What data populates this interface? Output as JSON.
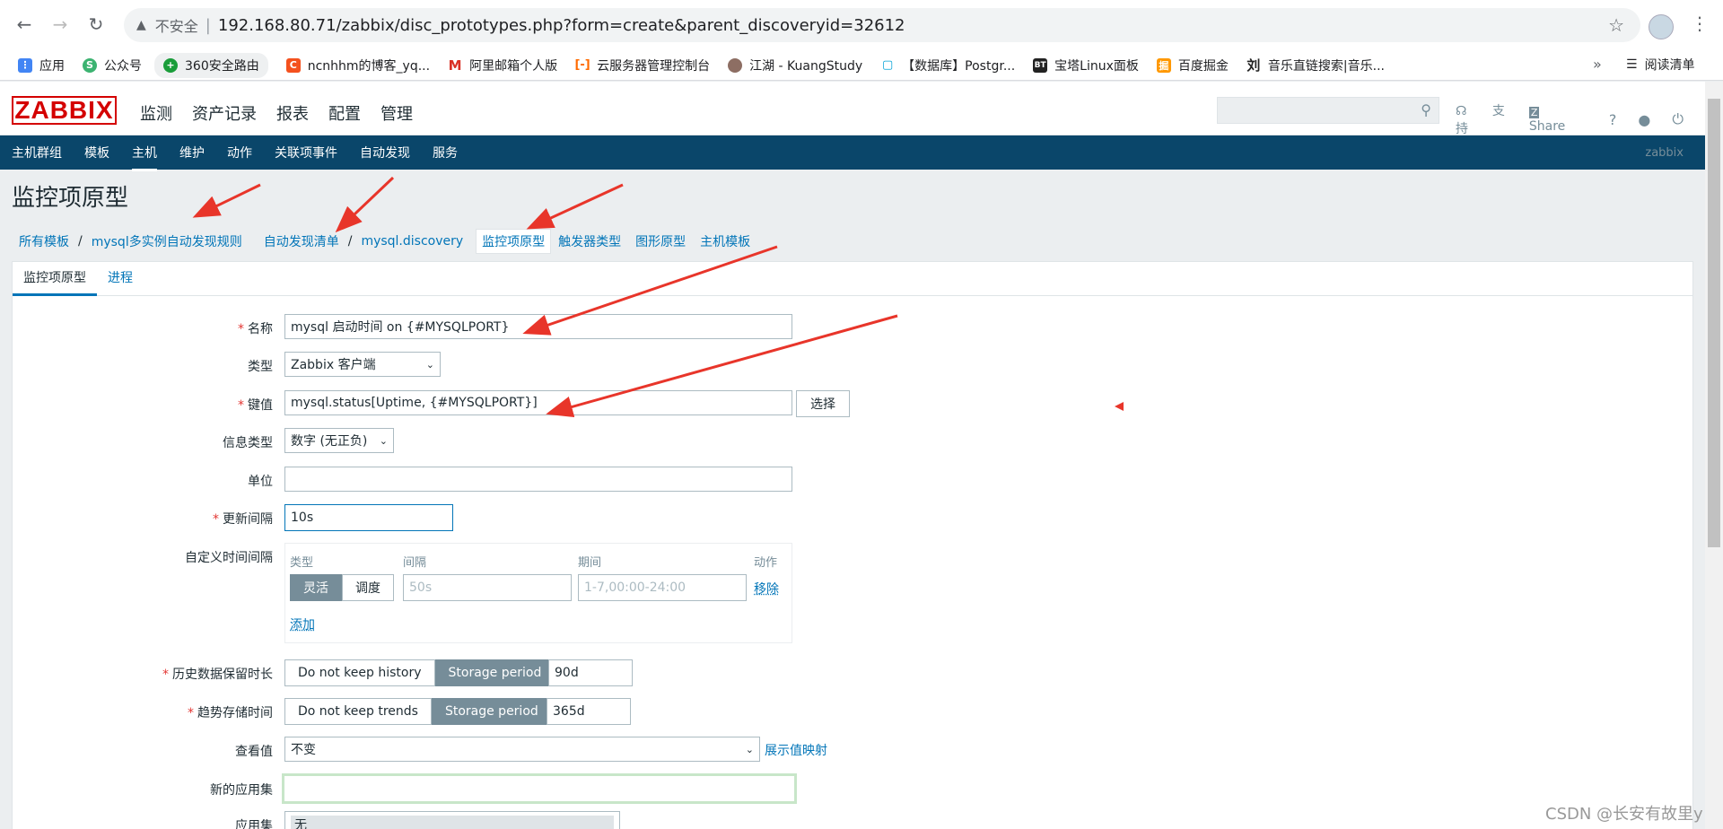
{
  "browser": {
    "insecure_label": "不安全",
    "url": "192.168.80.71/zabbix/disc_prototypes.php?form=create&parent_discoveryid=32612",
    "bookmarks": [
      "应用",
      "公众号",
      "360安全路由",
      "ncnhhm的博客_yq...",
      "阿里邮箱个人版",
      "云服务器管理控制台",
      "江湖 - KuangStudy",
      "【数据库】Postgr...",
      "宝塔Linux面板",
      "百度掘金",
      "音乐直链搜索|音乐..."
    ],
    "reading_list": "阅读清单",
    "more": "»"
  },
  "header": {
    "logo": "ZABBIX",
    "menu": [
      "监测",
      "资产记录",
      "报表",
      "配置",
      "管理"
    ],
    "support": "支持",
    "share": "Share",
    "help": "?"
  },
  "submenu": {
    "items": [
      "主机群组",
      "模板",
      "主机",
      "维护",
      "动作",
      "关联项事件",
      "自动发现",
      "服务"
    ],
    "user": "zabbix"
  },
  "page": {
    "title": "监控项原型",
    "breadcrumbs": [
      "所有模板",
      "mysql多实例自动发现规则",
      "自动发现清单",
      "mysql.discovery",
      "监控项原型",
      "触发器类型",
      "图形原型",
      "主机模板"
    ],
    "tabs": [
      "监控项原型",
      "进程"
    ]
  },
  "form": {
    "name_label": "名称",
    "name_value": "mysql 启动时间 on {#MYSQLPORT}",
    "type_label": "类型",
    "type_value": "Zabbix 客户端",
    "key_label": "键值",
    "key_value": "mysql.status[Uptime, {#MYSQLPORT}]",
    "select_button": "选择",
    "info_type_label": "信息类型",
    "info_type_value": "数字 (无正负)",
    "units_label": "单位",
    "units_value": "",
    "interval_label": "更新间隔",
    "interval_value": "10s",
    "custom_label": "自定义时间间隔",
    "custom_headers": [
      "类型",
      "间隔",
      "期间",
      "动作"
    ],
    "custom_flexible": "灵活",
    "custom_scheduling": "调度",
    "custom_interval_placeholder": "50s",
    "custom_period_placeholder": "1-7,00:00-24:00",
    "remove": "移除",
    "add": "添加",
    "history_label": "历史数据保留时长",
    "history_no": "Do not keep history",
    "history_storage": "Storage period",
    "history_value": "90d",
    "trends_label": "趋势存储时间",
    "trends_no": "Do not keep trends",
    "trends_storage": "Storage period",
    "trends_value": "365d",
    "valuemap_label": "查看值",
    "valuemap_value": "不变",
    "valuemap_link": "展示值映射",
    "new_app_label": "新的应用集",
    "app_label": "应用集",
    "app_first": "无"
  },
  "watermark": "CSDN @长安有故里y",
  "colors": {
    "zabbix_red": "#d40000",
    "nav_blue": "#0a466a",
    "link": "#0275b8",
    "arrow": "#e8352a"
  }
}
